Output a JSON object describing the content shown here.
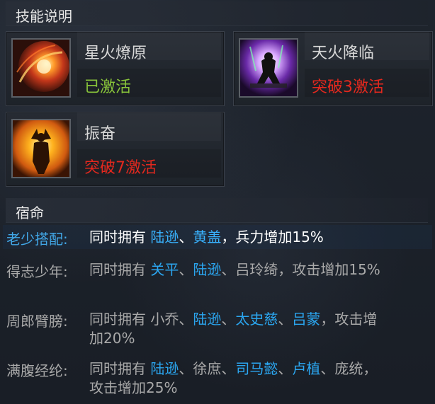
{
  "skill_header": "技能说明",
  "skills": [
    {
      "name": "星火燎原",
      "status": "已激活",
      "status_color": "#88c43a",
      "icon": "fire-vortex-icon"
    },
    {
      "name": "天火降临",
      "status": "突破3激活",
      "status_color": "#e3281e",
      "icon": "warrior-purple-flame-icon"
    },
    {
      "name": "振奋",
      "status": "突破7激活",
      "status_color": "#e3281e",
      "icon": "warrior-fire-aura-icon"
    }
  ],
  "fate_header": "宿命",
  "fates": [
    {
      "name": "老少搭配:",
      "active": true,
      "parts": [
        {
          "t": "同时拥有 ",
          "h": false
        },
        {
          "t": "陆逊",
          "h": true
        },
        {
          "t": "、",
          "h": false
        },
        {
          "t": "黄盖",
          "h": true
        },
        {
          "t": "，兵力增加15%",
          "h": false
        }
      ]
    },
    {
      "name": "得志少年:",
      "active": false,
      "parts": [
        {
          "t": "同时拥有 ",
          "h": false
        },
        {
          "t": "关平",
          "h": true
        },
        {
          "t": "、",
          "h": false
        },
        {
          "t": "陆逊",
          "h": true
        },
        {
          "t": "、吕玲绮，攻击增加15%",
          "h": false
        }
      ]
    },
    {
      "name": "周郎臂膀:",
      "active": false,
      "parts": [
        {
          "t": "同时拥有 小乔、",
          "h": false
        },
        {
          "t": "陆逊",
          "h": true
        },
        {
          "t": "、",
          "h": false
        },
        {
          "t": "太史慈",
          "h": true
        },
        {
          "t": "、",
          "h": false
        },
        {
          "t": "吕蒙",
          "h": true
        },
        {
          "t": "，攻击增加20%",
          "h": false
        }
      ]
    },
    {
      "name": "满腹经纶:",
      "active": false,
      "parts": [
        {
          "t": "同时拥有 ",
          "h": false
        },
        {
          "t": "陆逊",
          "h": true
        },
        {
          "t": "、徐庶、",
          "h": false
        },
        {
          "t": "司马懿",
          "h": true
        },
        {
          "t": "、",
          "h": false
        },
        {
          "t": "卢植",
          "h": true
        },
        {
          "t": "、庞统，攻击增加25%",
          "h": false
        }
      ]
    }
  ]
}
